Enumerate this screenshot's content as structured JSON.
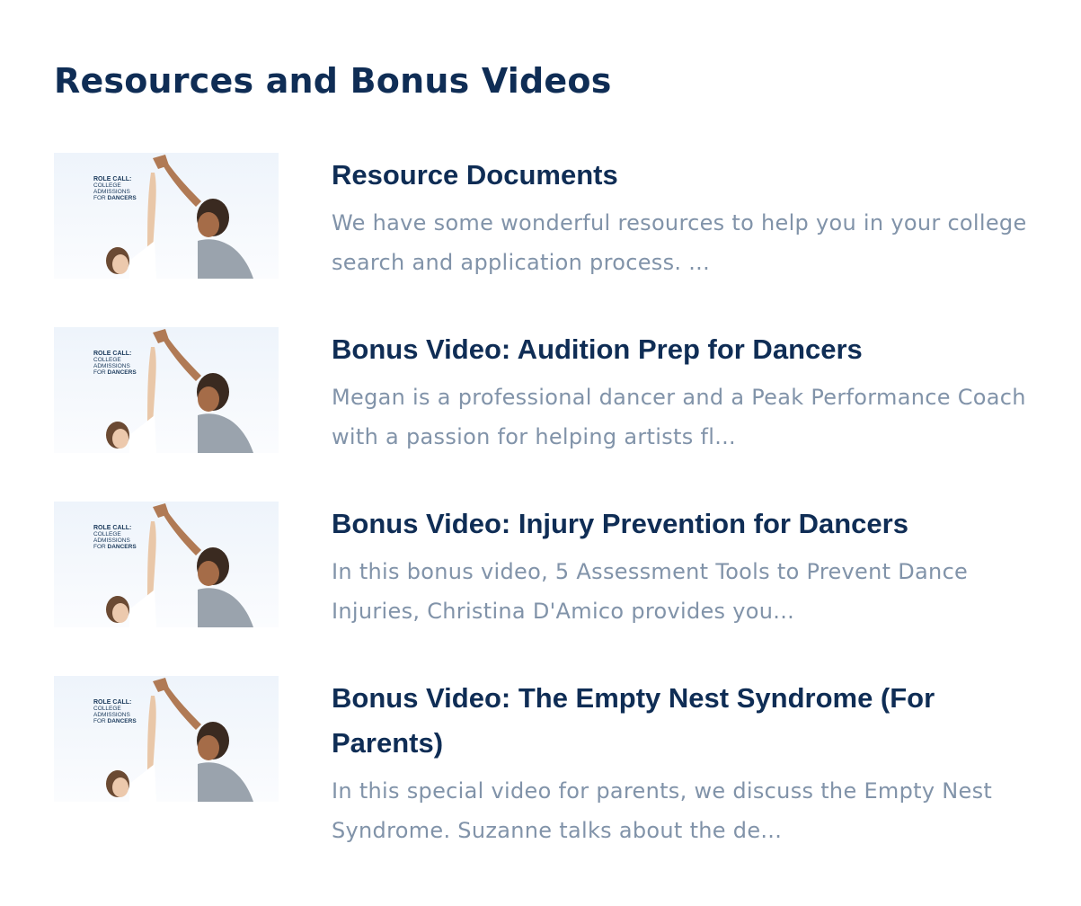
{
  "page": {
    "title": "Resources and Bonus Videos"
  },
  "thumbnail": {
    "text_line1": "ROLE CALL:",
    "text_line2": "COLLEGE",
    "text_line3": "ADMISSIONS",
    "text_line4_prefix": "FOR ",
    "text_line4_bold": "DANCERS"
  },
  "items": [
    {
      "title": "Resource Documents",
      "description": "We have some wonderful resources to help you in your college search and application process. ..."
    },
    {
      "title": "Bonus Video: Audition Prep for Dancers",
      "description": "Megan is a professional dancer and a Peak Performance Coach with a passion for helping artists fl..."
    },
    {
      "title": "Bonus Video: Injury Prevention for Dancers",
      "description": "In this bonus video, 5 Assessment Tools to Prevent Dance Injuries, Christina D'Amico provides you..."
    },
    {
      "title": "Bonus Video: The Empty Nest Syndrome (For Parents)",
      "description": "In this special video for parents, we discuss the Empty Nest Syndrome. Suzanne talks about the de..."
    }
  ],
  "colors": {
    "heading": "#0f2d55",
    "description": "#8193a9",
    "thumb_sky": "#f3f7fc",
    "thumb_text": "#1b3a5c"
  }
}
